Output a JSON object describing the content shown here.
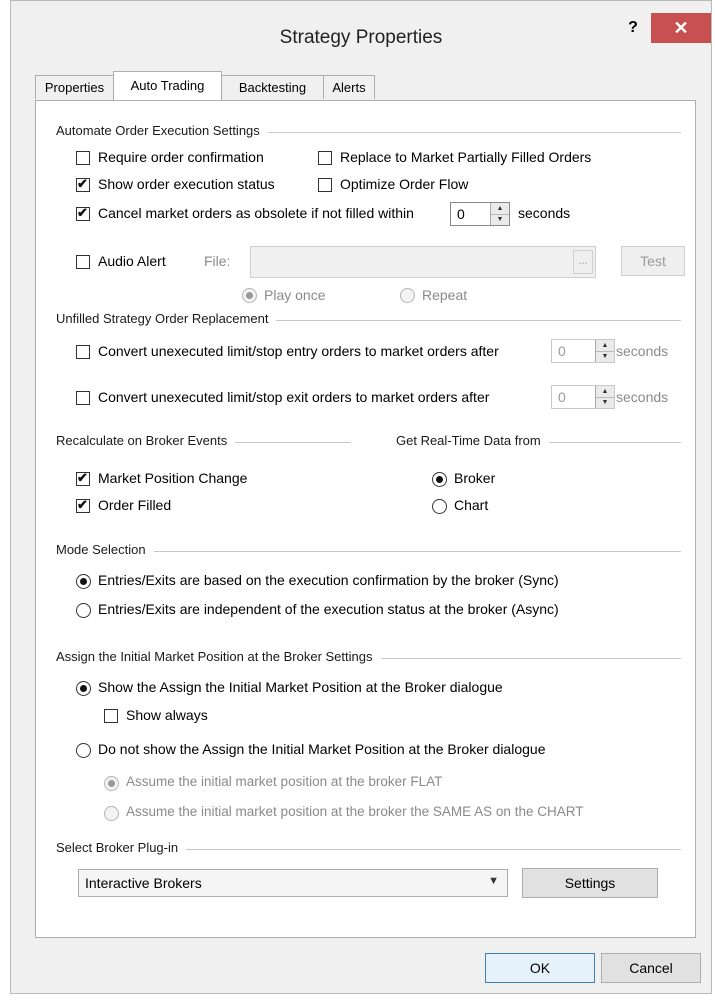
{
  "window": {
    "title": "Strategy Properties",
    "help_label": "?",
    "close_label": "✕"
  },
  "tabs": [
    {
      "label": "Properties",
      "active": false
    },
    {
      "label": "Auto Trading",
      "active": true
    },
    {
      "label": "Backtesting",
      "active": false
    },
    {
      "label": "Alerts",
      "active": false
    }
  ],
  "automate": {
    "title": "Automate Order Execution Settings",
    "require_confirmation": {
      "label": "Require order confirmation",
      "checked": false
    },
    "replace_market": {
      "label": "Replace to Market Partially Filled Orders",
      "checked": false
    },
    "show_status": {
      "label": "Show order execution status",
      "checked": true
    },
    "optimize_flow": {
      "label": "Optimize Order Flow",
      "checked": false
    },
    "cancel_obsolete": {
      "label": "Cancel market orders as obsolete if not filled within",
      "checked": true,
      "value": "0",
      "unit": "seconds"
    },
    "audio_alert": {
      "label": "Audio Alert",
      "checked": false,
      "file_label": "File:",
      "browse_label": "...",
      "test_label": "Test"
    },
    "play_once": {
      "label": "Play once",
      "checked": true
    },
    "repeat": {
      "label": "Repeat",
      "checked": false
    }
  },
  "unfilled": {
    "title": "Unfilled Strategy Order Replacement",
    "entry": {
      "label": "Convert unexecuted limit/stop entry orders to market orders after",
      "checked": false,
      "value": "0",
      "unit": "seconds"
    },
    "exit": {
      "label": "Convert unexecuted limit/stop exit orders to market orders after",
      "checked": false,
      "value": "0",
      "unit": "seconds"
    }
  },
  "recalc": {
    "title": "Recalculate on Broker Events",
    "position_change": {
      "label": "Market Position Change",
      "checked": true
    },
    "order_filled": {
      "label": "Order Filled",
      "checked": true
    }
  },
  "realtime": {
    "title": "Get Real-Time Data from",
    "broker": {
      "label": "Broker",
      "checked": true
    },
    "chart": {
      "label": "Chart",
      "checked": false
    }
  },
  "mode": {
    "title": "Mode Selection",
    "sync": {
      "label": "Entries/Exits are based on the execution confirmation by the broker (Sync)",
      "checked": true
    },
    "async": {
      "label": "Entries/Exits are independent of the execution status at the broker (Async)",
      "checked": false
    }
  },
  "assign": {
    "title": "Assign the Initial Market Position at the Broker Settings",
    "show_dialog": {
      "label": "Show the Assign the Initial Market Position at the Broker dialogue",
      "checked": true
    },
    "show_always": {
      "label": "Show always",
      "checked": false
    },
    "no_dialog": {
      "label": "Do not show the Assign the Initial Market Position at the Broker dialogue",
      "checked": false
    },
    "assume_flat": {
      "label": "Assume the initial market position at the broker FLAT",
      "checked": true
    },
    "assume_same": {
      "label": "Assume the initial market position at the broker the SAME AS on the CHART",
      "checked": false
    }
  },
  "plugin": {
    "title": "Select Broker Plug-in",
    "selected": "Interactive Brokers",
    "settings_label": "Settings"
  },
  "footer": {
    "ok_label": "OK",
    "cancel_label": "Cancel"
  }
}
